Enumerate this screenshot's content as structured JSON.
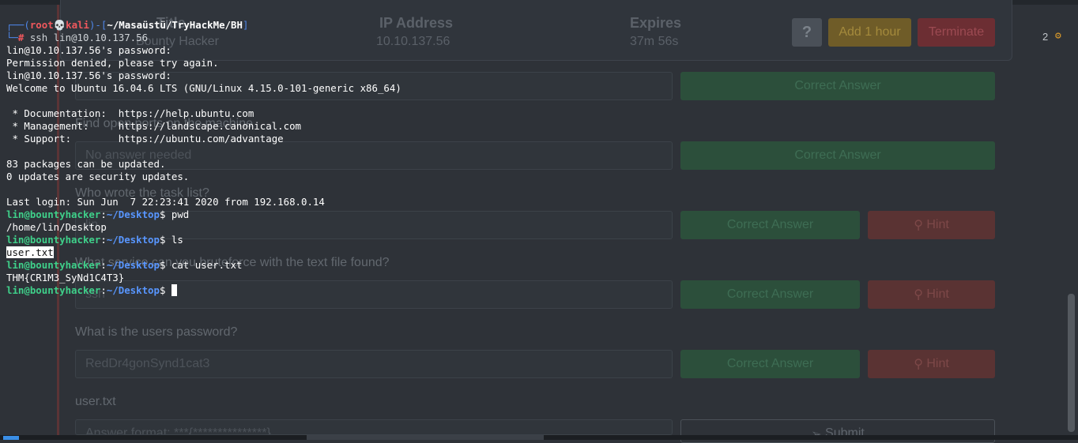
{
  "background_page": {
    "info_headers": [
      "Title",
      "IP Address",
      "Expires"
    ],
    "info_values": [
      "Bounty Hacker",
      "10.10.137.56",
      "37m 56s"
    ],
    "buttons": {
      "help": "?",
      "add_hour": "Add 1 hour",
      "terminate": "Terminate"
    },
    "notification_count": "2",
    "questions": [
      {
        "question": "",
        "answer": "",
        "button": "Correct Answer"
      },
      {
        "question": "Find open ports on the machine",
        "answer": "No answer needed",
        "button": "Correct Answer"
      },
      {
        "question": "Who wrote the task list?",
        "answer": "lin",
        "button": "Correct Answer",
        "hint": "Hint"
      },
      {
        "question": "What service can you bruteforce with the text file found?",
        "answer": "ssh",
        "button": "Correct Answer",
        "hint": "Hint"
      },
      {
        "question": "What is the users password?",
        "answer": "RedDr4gonSynd1cat3",
        "button": "Correct Answer",
        "hint": "Hint"
      },
      {
        "question": "user.txt",
        "placeholder": "Answer format: ***{***************}",
        "button": "Submit"
      }
    ]
  },
  "terminal": {
    "prompt_header": {
      "corner_top": "┌──(",
      "user": "root",
      "skull": "💀",
      "host": "kali",
      "path_sep": ")-[",
      "path": "~/Masaüstü/TryHackMe/BH",
      "path_end": "]",
      "corner_bottom": "└─",
      "hash": "#",
      "command": " ssh lin@10.10.137.56"
    },
    "output_1": [
      "lin@10.10.137.56's password:",
      "Permission denied, please try again.",
      "lin@10.10.137.56's password:",
      "Welcome to Ubuntu 16.04.6 LTS (GNU/Linux 4.15.0-101-generic x86_64)",
      "",
      " * Documentation:  https://help.ubuntu.com",
      " * Management:     https://landscape.canonical.com",
      " * Support:        https://ubuntu.com/advantage",
      "",
      "83 packages can be updated.",
      "0 updates are security updates.",
      "",
      "Last login: Sun Jun  7 22:23:41 2020 from 192.168.0.14"
    ],
    "shell_user": "lin@bountyhacker",
    "shell_colon": ":",
    "shell_path": "~/Desktop",
    "shell_dollar": "$ ",
    "commands": {
      "pwd": "pwd",
      "pwd_output": "/home/lin/Desktop",
      "ls": "ls",
      "ls_output": "user.txt",
      "cat": "cat user.txt",
      "cat_output": "THM{CR1M3_SyNd1C4T3}"
    }
  }
}
